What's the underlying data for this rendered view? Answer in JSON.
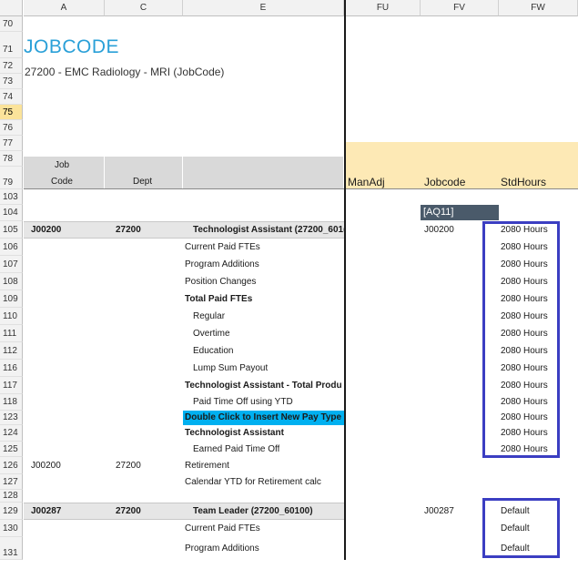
{
  "columns": [
    {
      "label": "A"
    },
    {
      "label": "C"
    },
    {
      "label": "E"
    },
    {
      "label": "FU"
    },
    {
      "label": "FV"
    },
    {
      "label": "FW"
    }
  ],
  "title": "JOBCODE",
  "subtitle": "27200 - EMC Radiology - MRI (JobCode)",
  "header": {
    "job": "Job",
    "code": "Code",
    "dept": "Dept",
    "manadj": "ManAdj",
    "jobcode": "Jobcode",
    "stdhours": "StdHours",
    "aq_label": "[AQ11]"
  },
  "rows": [
    {
      "num": "70"
    },
    {
      "num": "71"
    },
    {
      "num": "72"
    },
    {
      "num": "73"
    },
    {
      "num": "74"
    },
    {
      "num": "75"
    },
    {
      "num": "76"
    },
    {
      "num": "77"
    },
    {
      "num": "78"
    },
    {
      "num": "79"
    },
    {
      "num": "103"
    },
    {
      "num": "104"
    },
    {
      "num": "105",
      "a": "J00200",
      "c": "27200",
      "e": "Technologist Assistant (27200_601(",
      "fv": "J00200",
      "fw": "2080 Hours"
    },
    {
      "num": "106",
      "e": "Current Paid FTEs",
      "fw": "2080 Hours"
    },
    {
      "num": "107",
      "e": "Program Additions",
      "fw": "2080 Hours"
    },
    {
      "num": "108",
      "e": "Position Changes",
      "fw": "2080 Hours"
    },
    {
      "num": "109",
      "e": "Total Paid FTEs",
      "fw": "2080 Hours"
    },
    {
      "num": "110",
      "e": "Regular",
      "fw": "2080 Hours"
    },
    {
      "num": "111",
      "e": "Overtime",
      "fw": "2080 Hours"
    },
    {
      "num": "112",
      "e": "Education",
      "fw": "2080 Hours"
    },
    {
      "num": "116",
      "e": "Lump Sum Payout",
      "fw": "2080 Hours"
    },
    {
      "num": "117",
      "e": "Technologist Assistant - Total Produ",
      "fw": "2080 Hours"
    },
    {
      "num": "118",
      "e": "Paid Time Off using YTD",
      "fw": "2080 Hours"
    },
    {
      "num": "123",
      "e": "Double Click to Insert New Pay Type",
      "fw": "2080 Hours"
    },
    {
      "num": "124",
      "e": "Technologist Assistant",
      "fw": "2080 Hours"
    },
    {
      "num": "125",
      "e": "Earned Paid Time Off",
      "fw": "2080 Hours"
    },
    {
      "num": "126",
      "a": "J00200",
      "c": "27200",
      "e": "Retirement"
    },
    {
      "num": "127",
      "e": "Calendar YTD for Retirement calc"
    },
    {
      "num": "128"
    },
    {
      "num": "129",
      "a": "J00287",
      "c": "27200",
      "e": "Team Leader (27200_60100)",
      "fv": "J00287",
      "fw": "Default"
    },
    {
      "num": "130",
      "e": "Current Paid FTEs",
      "fw": "Default"
    },
    {
      "num": "131",
      "e": "Program Additions",
      "fw": "Default"
    }
  ]
}
